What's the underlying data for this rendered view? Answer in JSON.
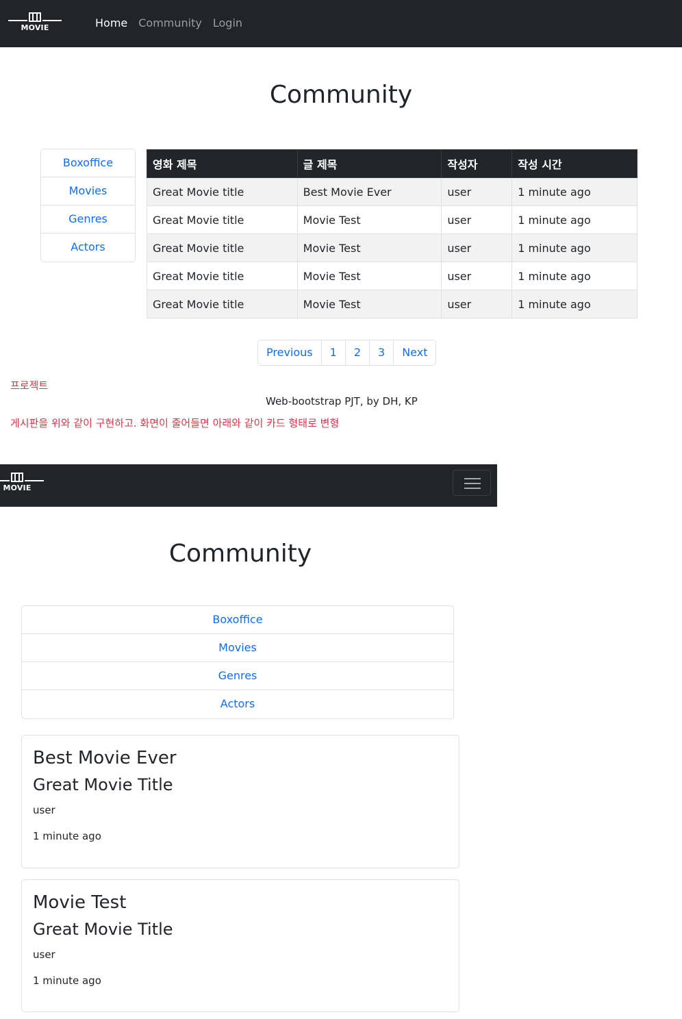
{
  "brand": {
    "logo_text": "MOVIE"
  },
  "nav": {
    "home": "Home",
    "community": "Community",
    "login": "Login"
  },
  "desktop": {
    "title": "Community",
    "sidebar": [
      "Boxoffice",
      "Movies",
      "Genres",
      "Actors"
    ],
    "table": {
      "headers": [
        "영화 제목",
        "글 제목",
        "작성자",
        "작성 시간"
      ],
      "rows": [
        [
          "Great Movie title",
          "Best Movie Ever",
          "user",
          "1 minute ago"
        ],
        [
          "Great Movie title",
          "Movie Test",
          "user",
          "1 minute ago"
        ],
        [
          "Great Movie title",
          "Movie Test",
          "user",
          "1 minute ago"
        ],
        [
          "Great Movie title",
          "Movie Test",
          "user",
          "1 minute ago"
        ],
        [
          "Great Movie title",
          "Movie Test",
          "user",
          "1 minute ago"
        ]
      ]
    },
    "pagination": [
      "Previous",
      "1",
      "2",
      "3",
      "Next"
    ]
  },
  "notes": {
    "project": "프로젝트",
    "footer": "Web-bootstrap PJT, by DH, KP",
    "description": "게시판을 위와 같이 구현하고. 화면이 줄어들면 아래와 같이 카드 형태로 변형"
  },
  "mobile": {
    "title": "Community",
    "sidebar": [
      "Boxoffice",
      "Movies",
      "Genres",
      "Actors"
    ],
    "cards": [
      {
        "title": "Best Movie Ever",
        "movie": "Great Movie Title",
        "author": "user",
        "time": "1 minute ago"
      },
      {
        "title": "Movie Test",
        "movie": "Great Movie Title",
        "author": "user",
        "time": "1 minute ago"
      }
    ]
  },
  "colors": {
    "navbar": "#212529",
    "link": "#0d6efd",
    "note": "#dc3545",
    "stripe": "#f2f2f2"
  }
}
